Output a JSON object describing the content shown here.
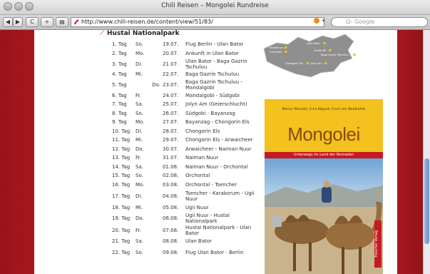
{
  "window": {
    "title": "Chili Reisen – Mongolei Rundreise"
  },
  "toolbar": {
    "back_glyph": "◀",
    "forward_glyph": "▶",
    "reload_glyph": "C",
    "add_glyph": "+",
    "print_glyph": "▤",
    "url": "http://www.chili-reisen.de/content/view/51/83/",
    "search_placeholder": "Q- Google"
  },
  "page": {
    "heading": "Hustai Nationalpark",
    "itinerary": [
      {
        "tag": "1. Tag",
        "day": "So.",
        "date": "19.07.",
        "route": "Flug Berlin - Ulan Bator"
      },
      {
        "tag": "2. Tag",
        "day": "Mo.",
        "date": "20.07.",
        "route": "Ankunft in Ulan Bator"
      },
      {
        "tag": "3. Tag",
        "day": "Di.",
        "date": "21.07.",
        "route": "Ulan Bator - Baga Gazrin Tschuluu"
      },
      {
        "tag": "4. Tag",
        "day": "Mi.",
        "date": "22.07.",
        "route": "Baga Gazrin Tschuluu"
      },
      {
        "tag": "5. Tag",
        "day": "Do.",
        "date": "23.07.",
        "route": "Baga Gazrin Tschuluu - Mandalgobi"
      },
      {
        "tag": "6. Tag",
        "day": "Fr.",
        "date": "24.07.",
        "route": "Mandalgobi - Südgobi"
      },
      {
        "tag": "7. Tag",
        "day": "Sa.",
        "date": "25.07.",
        "route": "Jolyn Am (Geierschlucht)"
      },
      {
        "tag": "8. Tag",
        "day": "So.",
        "date": "26.07.",
        "route": "Südgobi - Bayanzag"
      },
      {
        "tag": "9. Tag",
        "day": "Mo.",
        "date": "27.07.",
        "route": "Bayanzag - Chongorin Els"
      },
      {
        "tag": "10. Tag",
        "day": "Di.",
        "date": "28.07.",
        "route": "Chongorin Els"
      },
      {
        "tag": "11. Tag",
        "day": "Mi.",
        "date": "29.07.",
        "route": "Chongorin Els - Arwaicheer"
      },
      {
        "tag": "12. Tag",
        "day": "Do.",
        "date": "30.07.",
        "route": "Arwaicheer - Naiman Nuur"
      },
      {
        "tag": "13. Tag",
        "day": "Fr.",
        "date": "31.07.",
        "route": "Naiman Nuur"
      },
      {
        "tag": "14. Tag",
        "day": "Sa.",
        "date": "01.08.",
        "route": "Naiman Nuur - Orchontal"
      },
      {
        "tag": "15. Tag",
        "day": "So.",
        "date": "02.08.",
        "route": "Orchontal"
      },
      {
        "tag": "16. Tag",
        "day": "Mo.",
        "date": "03.08.",
        "route": "Orchontal - Tsencher"
      },
      {
        "tag": "17. Tag",
        "day": "Di.",
        "date": "04.08.",
        "route": "Tsencher - Karakorum - Ugii Nuur"
      },
      {
        "tag": "18. Tag",
        "day": "Mi.",
        "date": "05.08.",
        "route": "Ugii Nuur"
      },
      {
        "tag": "19. Tag",
        "day": "Do.",
        "date": "06.08.",
        "route": "Ugii Nuur - Hustai Nationalpark"
      },
      {
        "tag": "20. Tag",
        "day": "Fr.",
        "date": "07.08.",
        "route": "Hustai Nationalpark - Ulan Bator"
      },
      {
        "tag": "21. Tag",
        "day": "Sa.",
        "date": "08.08.",
        "route": "Ulan Bator"
      },
      {
        "tag": "22. Tag",
        "day": "So.",
        "date": "09.08.",
        "route": "Flug Ulan Bator - Berlin"
      }
    ],
    "map_labels": [
      "Karakorum",
      "Orchontal",
      "Ulan Bator",
      "Hustai NP",
      "Baga Gazrin Tschuluu",
      "Chongorin Els",
      "Jolyn Am"
    ],
    "book": {
      "authors": "Marion Wisotzki, Erna Käppeli, Ernst von Waldenfels",
      "title": "Mongolei",
      "subtitle": "Unterwegs im Land der Nomaden",
      "publisher": "Trescher Verlag"
    }
  },
  "colors": {
    "accent": "#c6161e",
    "sidebar": "#a8161e",
    "book_yellow": "#f3c21f"
  }
}
